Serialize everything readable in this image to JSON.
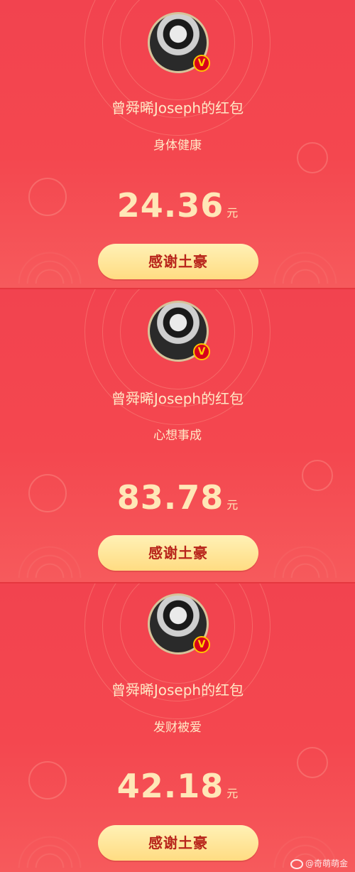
{
  "panels": [
    {
      "sender": "曾舜晞Joseph的红包",
      "wish": "身体健康",
      "amount": "24.36",
      "unit": "元",
      "button": "感谢土豪",
      "badge": "V"
    },
    {
      "sender": "曾舜晞Joseph的红包",
      "wish": "心想事成",
      "amount": "83.78",
      "unit": "元",
      "button": "感谢土豪",
      "badge": "V"
    },
    {
      "sender": "曾舜晞Joseph的红包",
      "wish": "发财被爱",
      "amount": "42.18",
      "unit": "元",
      "button": "感谢土豪",
      "badge": "V"
    }
  ],
  "watermark": "@奇萌萌金",
  "colors": {
    "background": "#f2434f",
    "text_gold": "#ffe7b7",
    "button_bg": "#ffe08f",
    "button_text": "#b8241b"
  }
}
